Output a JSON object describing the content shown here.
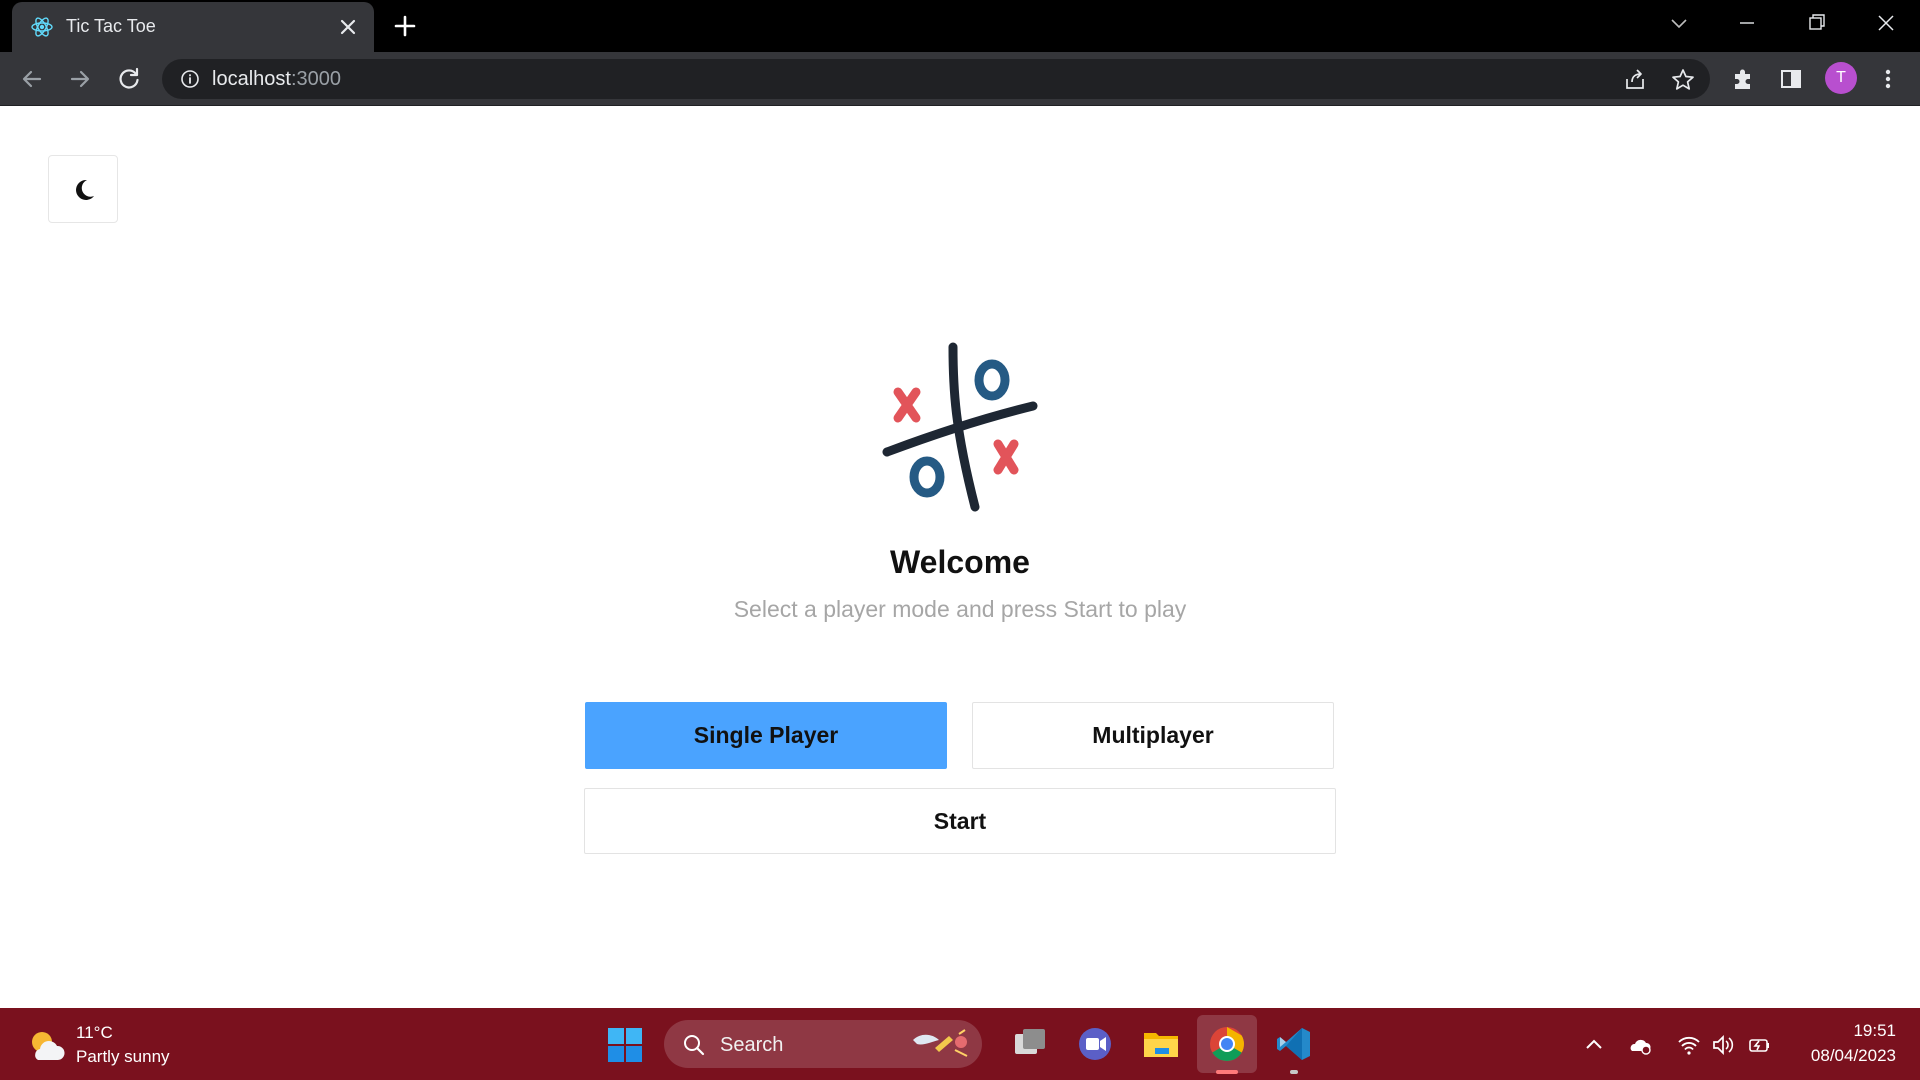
{
  "browser": {
    "tab_title": "Tic Tac Toe",
    "url_host": "localhost",
    "url_port": ":3000",
    "profile_initial": "T"
  },
  "page": {
    "welcome_title": "Welcome",
    "subtitle": "Select a player mode and press Start to play",
    "modes": [
      {
        "label": "Single Player",
        "selected": true
      },
      {
        "label": "Multiplayer",
        "selected": false
      }
    ],
    "start_label": "Start",
    "accent_color": "#4aa3ff",
    "logo_x_color": "#e2545a",
    "logo_o_color": "#255a84"
  },
  "taskbar": {
    "weather_temp": "11°C",
    "weather_desc": "Partly sunny",
    "search_label": "Search",
    "clock_time": "19:51",
    "clock_date": "08/04/2023",
    "taskbar_color": "#7a111e"
  }
}
